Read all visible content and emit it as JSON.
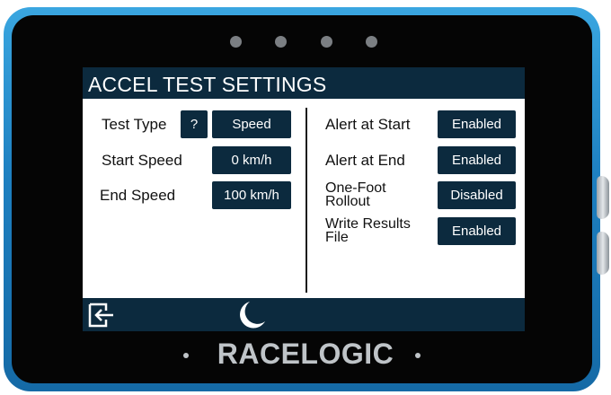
{
  "screen": {
    "title": "ACCEL TEST SETTINGS"
  },
  "left_settings": [
    {
      "label": "Test Type",
      "value": "Speed",
      "help": "?"
    },
    {
      "label": "Start Speed",
      "value": "0 km/h"
    },
    {
      "label": "End Speed",
      "value": "100 km/h"
    }
  ],
  "right_settings": [
    {
      "label": "Alert at Start",
      "value": "Enabled"
    },
    {
      "label": "Alert at End",
      "value": "Enabled"
    },
    {
      "label": "One-Foot Rollout",
      "value": "Disabled"
    },
    {
      "label": "Write Results File",
      "value": "Enabled"
    }
  ],
  "toolbar": {
    "exit_icon": "exit-icon",
    "night_icon": "moon-icon"
  },
  "device": {
    "brand": "RACELOGIC"
  },
  "colors": {
    "ui_navy": "#0c2a3e",
    "bezel_blue": "#1d7fc0"
  }
}
